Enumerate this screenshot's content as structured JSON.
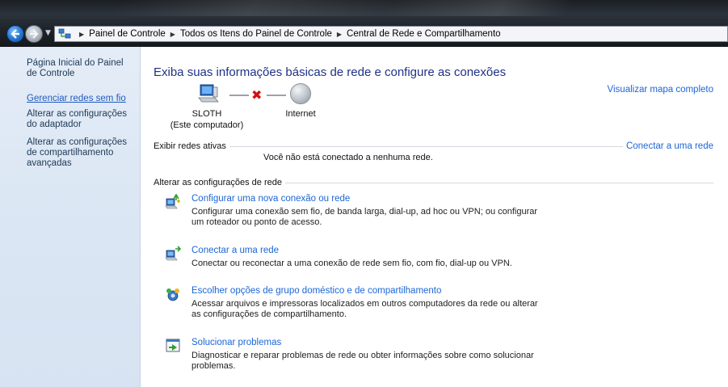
{
  "breadcrumbs": [
    "Painel de Controle",
    "Todos os Itens do Painel de Controle",
    "Central de Rede e Compartilhamento"
  ],
  "sidebar": {
    "home": "Página Inicial do Painel de Controle",
    "items": [
      {
        "label": "Gerenciar redes sem fio"
      },
      {
        "label": "Alterar as configurações do adaptador"
      },
      {
        "label": "Alterar as configurações de compartilhamento avançadas"
      }
    ]
  },
  "main": {
    "title": "Exiba suas informações básicas de rede e configure as conexões",
    "view_map": "Visualizar mapa completo",
    "computer_name": "SLOTH",
    "computer_sub": "(Este computador)",
    "internet_label": "Internet",
    "active_networks_label": "Exibir redes ativas",
    "connect_link": "Conectar a uma rede",
    "no_network": "Você não está conectado a nenhuma rede.",
    "change_settings_label": "Alterar as configurações de rede",
    "tasks": [
      {
        "title": "Configurar uma nova conexão ou rede",
        "desc": "Configurar uma conexão sem fio, de banda larga, dial-up, ad hoc ou VPN; ou configurar um roteador ou ponto de acesso.",
        "icon": "new-connection-icon"
      },
      {
        "title": "Conectar a uma rede",
        "desc": "Conectar ou reconectar a uma conexão de rede sem fio, com fio, dial-up ou VPN.",
        "icon": "connect-network-icon"
      },
      {
        "title": "Escolher opções de grupo doméstico e de compartilhamento",
        "desc": "Acessar arquivos e impressoras localizados em outros computadores da rede ou alterar as configurações de compartilhamento.",
        "icon": "homegroup-icon"
      },
      {
        "title": "Solucionar problemas",
        "desc": "Diagnosticar e reparar problemas de rede ou obter informações sobre como solucionar problemas.",
        "icon": "troubleshoot-icon"
      }
    ]
  },
  "colors": {
    "link": "#1c66d6",
    "title": "#1e3287",
    "error_x": "#d40f0f",
    "sidebar_bg": "#dbe6f4"
  }
}
